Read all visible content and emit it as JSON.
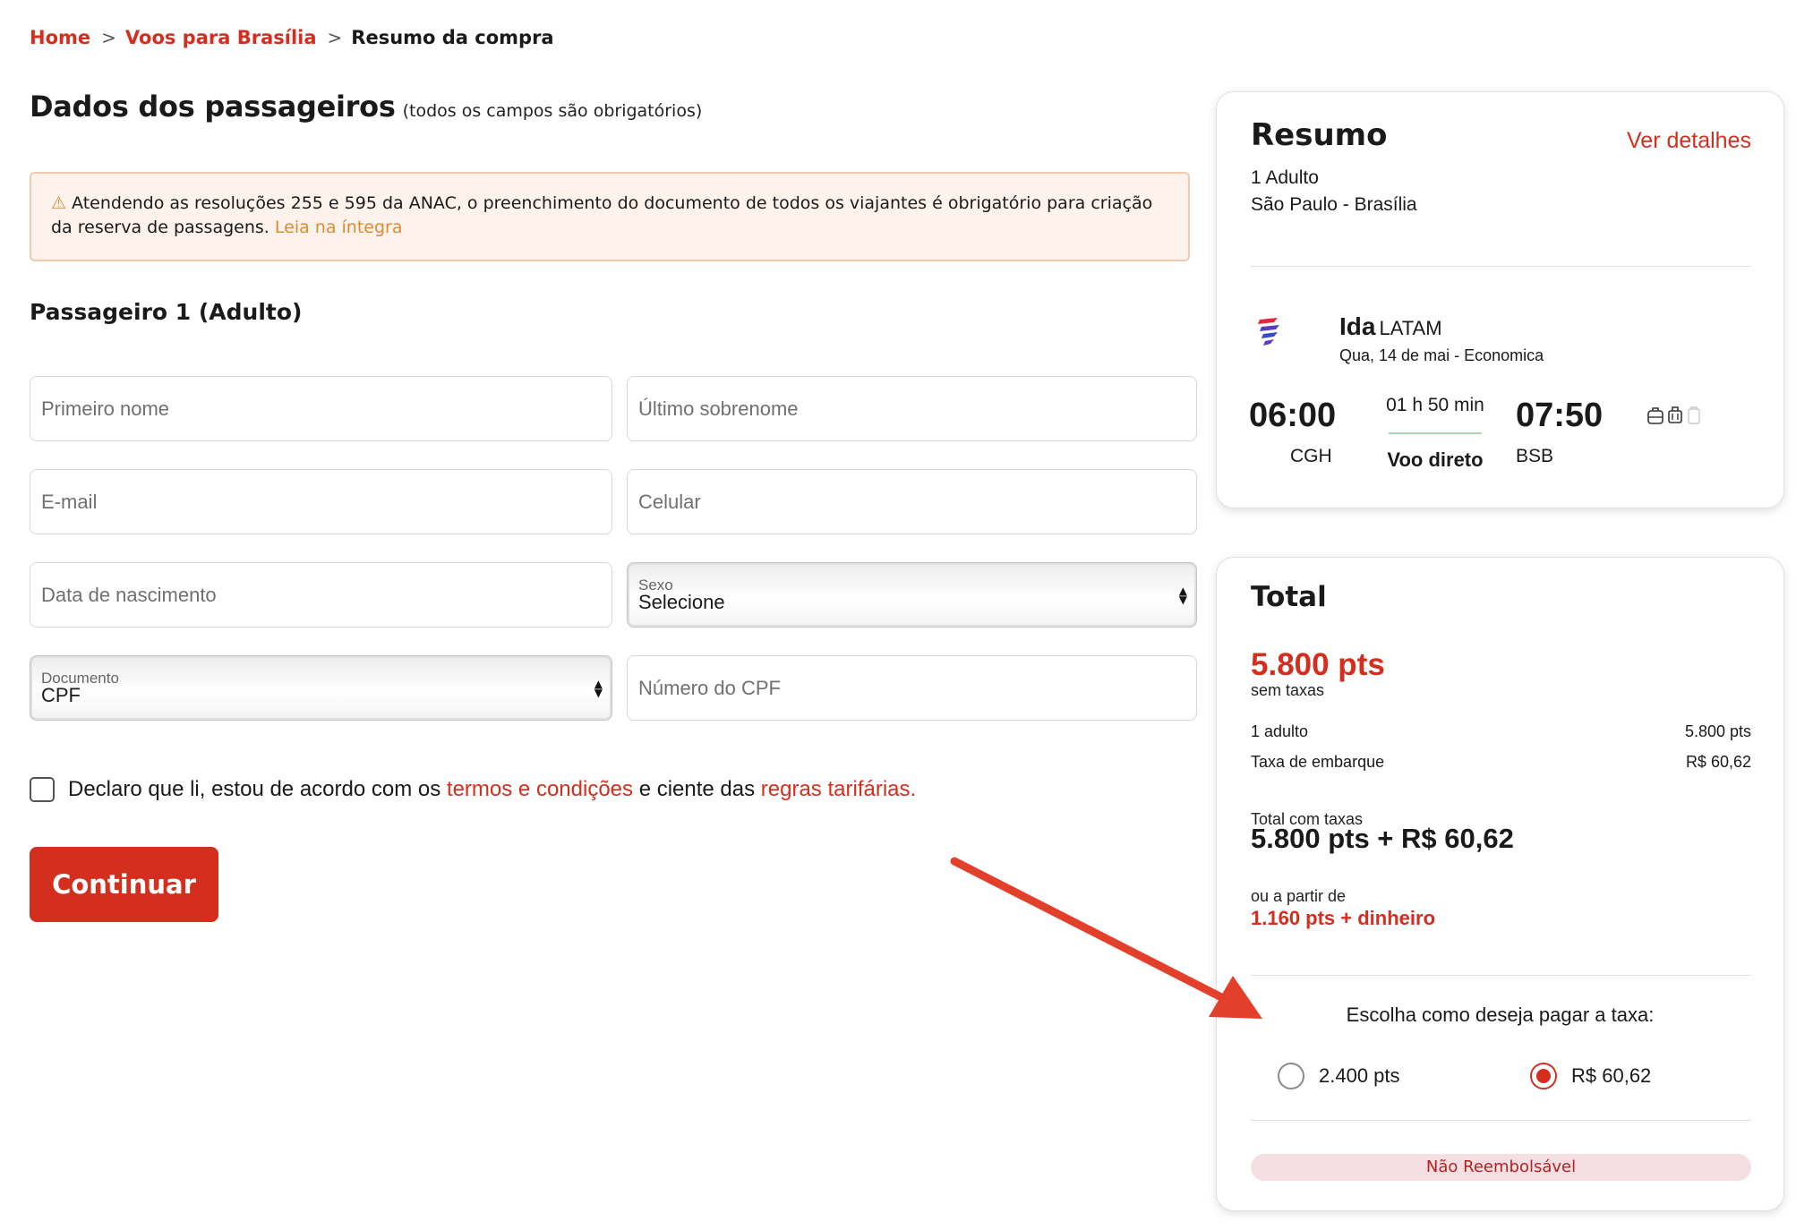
{
  "breadcrumb": {
    "home": "Home",
    "flights": "Voos para Brasília",
    "current": "Resumo da compra",
    "separator": ">"
  },
  "page": {
    "title": "Dados dos passageiros",
    "subtitle": "(todos os campos são obrigatórios)"
  },
  "notice": {
    "icon": "warning-icon",
    "text": "Atendendo as resoluções 255 e 595 da ANAC, o preenchimento do documento de todos os viajantes é obrigatório para criação da reserva de passagens.",
    "link": "Leia na íntegra"
  },
  "passenger": {
    "title": "Passageiro 1 (Adulto)",
    "first_name_placeholder": "Primeiro nome",
    "last_name_placeholder": "Último sobrenome",
    "email_placeholder": "E-mail",
    "phone_placeholder": "Celular",
    "birthdate_placeholder": "Data de nascimento",
    "gender_label": "Sexo",
    "gender_value": "Selecione",
    "document_label": "Documento",
    "document_value": "CPF",
    "cpf_placeholder": "Número do CPF"
  },
  "terms": {
    "text_before": "Declaro que li, estou de acordo com os",
    "link1": "termos e condições",
    "text_middle": "e ciente das",
    "link2": "regras tarifárias."
  },
  "continue_label": "Continuar",
  "summary": {
    "title": "Resumo",
    "details_link": "Ver detalhes",
    "passengers": "1 Adulto",
    "route": "São Paulo - Brasília",
    "flight": {
      "direction": "Ida",
      "airline": "LATAM",
      "date_class": "Qua, 14 de mai - Economica",
      "depart_time": "06:00",
      "depart_airport": "CGH",
      "duration": "01 h 50 min",
      "stops": "Voo direto",
      "arrive_time": "07:50",
      "arrive_airport": "BSB"
    }
  },
  "total": {
    "title": "Total",
    "points": "5.800 pts",
    "points_note": "sem taxas",
    "lines": [
      {
        "label": "1 adulto",
        "value": "5.800 pts"
      },
      {
        "label": "Taxa de embarque",
        "value": "R$ 60,62"
      }
    ],
    "total_label": "Total com taxas",
    "total_value": "5.800 pts + R$ 60,62",
    "alt_label": "ou a partir de",
    "alt_value": "1.160 pts + dinheiro",
    "pay_question": "Escolha como deseja pagar a taxa:",
    "pay_options": [
      {
        "label": "2.400 pts",
        "selected": false
      },
      {
        "label": "R$ 60,62",
        "selected": true
      }
    ],
    "badge": "Não Reembolsável"
  },
  "colors": {
    "brand_red": "#d42e1f",
    "notice_bg": "#fdf2ec",
    "notice_link": "#e08a2e",
    "badge_bg": "#f6dfe2"
  }
}
